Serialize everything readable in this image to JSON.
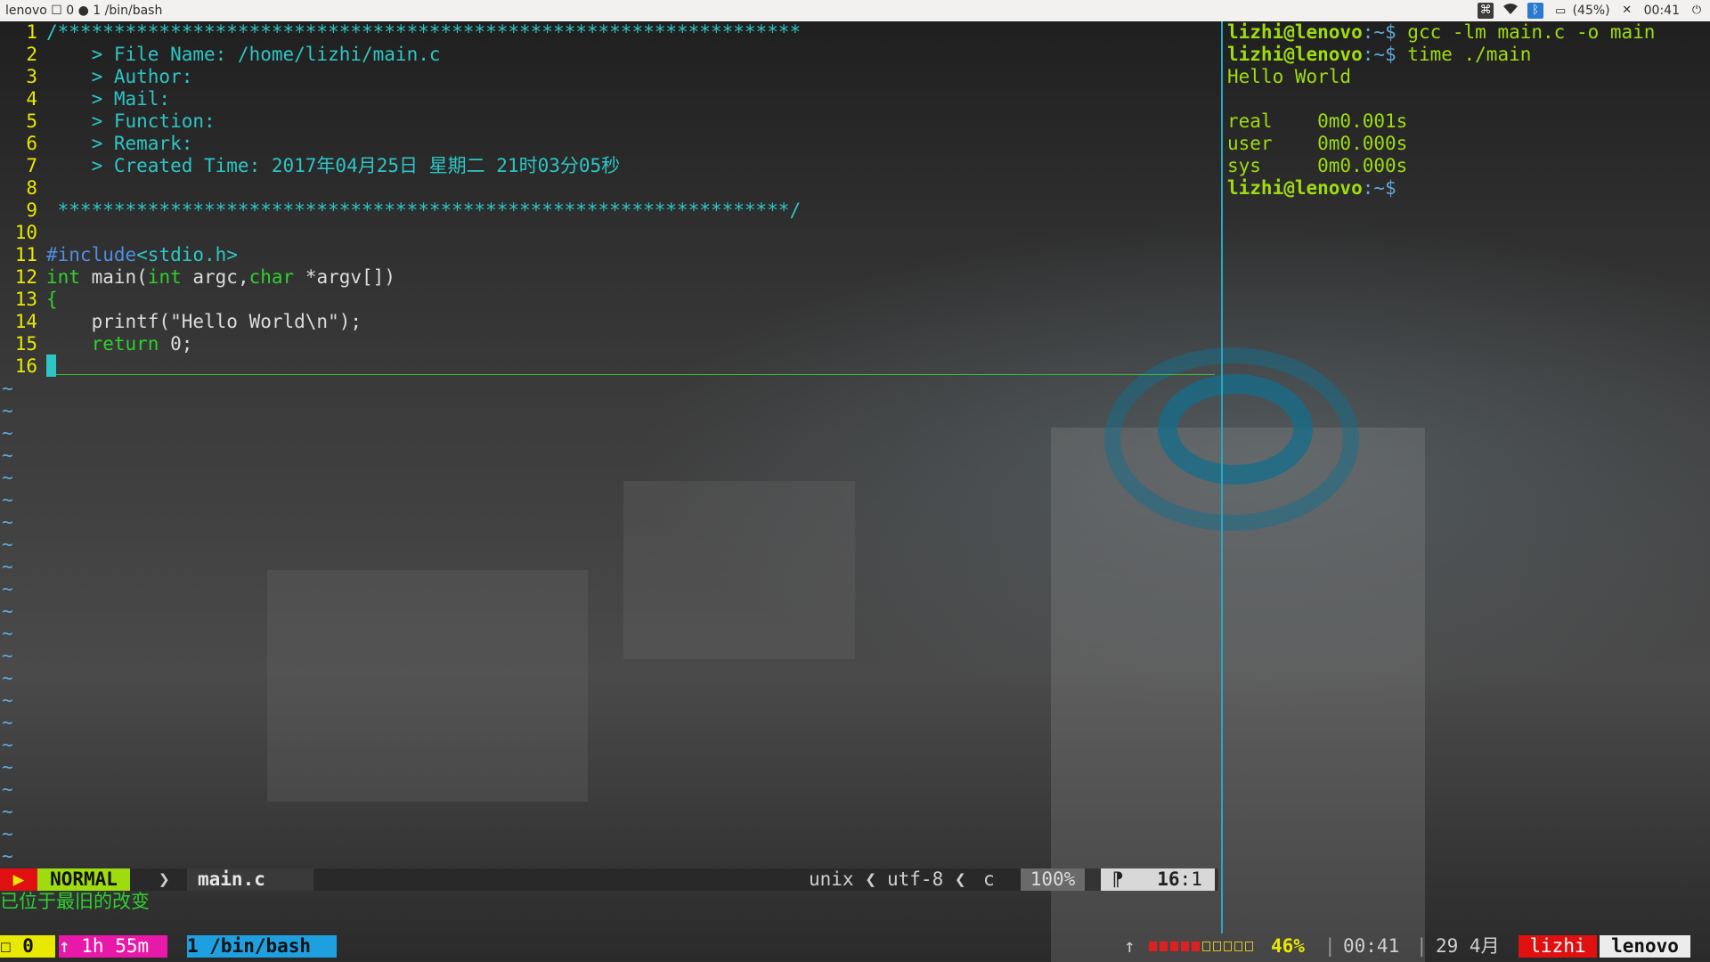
{
  "colors": {
    "accent": "#2ec5c5",
    "normal_mode": "#9edc10",
    "prompt": "#9edc10",
    "tmux_session": "#e8e800",
    "tmux_uptime": "#e818a8",
    "tmux_window": "#1ea0e0"
  },
  "topbar": {
    "title": "lenovo ☐ 0 ● 1 /bin/bash",
    "battery": "(45%)",
    "time": "00:41",
    "icons": [
      "keyboard-icon",
      "wifi-icon",
      "bluetooth-icon",
      "battery-icon",
      "mute-icon",
      "power-icon"
    ]
  },
  "vim": {
    "lines": [
      {
        "n": "1",
        "text": "/******************************************************************"
      },
      {
        "n": "2",
        "text": "    > File Name: /home/lizhi/main.c"
      },
      {
        "n": "3",
        "text": "    > Author:"
      },
      {
        "n": "4",
        "text": "    > Mail:"
      },
      {
        "n": "5",
        "text": "    > Function:"
      },
      {
        "n": "6",
        "text": "    > Remark:"
      },
      {
        "n": "7",
        "text": "    > Created Time: 2017年04月25日 星期二 21时03分05秒"
      },
      {
        "n": "8",
        "text": ""
      },
      {
        "n": "9",
        "text": " *****************************************************************/"
      },
      {
        "n": "10",
        "text": ""
      },
      {
        "n": "11",
        "include": "#include",
        "header": "<stdio.h>"
      },
      {
        "n": "12",
        "kw_int": "int",
        "fn": " main(",
        "kw_int2": "int",
        "args": " argc,",
        "kw_char": "char",
        "ptr": " *argv[])"
      },
      {
        "n": "13",
        "text": "{"
      },
      {
        "n": "14",
        "text": "    printf(\"Hello World\\n\");"
      },
      {
        "n": "15",
        "kw": "    return",
        "num": " 0;"
      },
      {
        "n": "16",
        "text": "}"
      }
    ],
    "tildes": [
      "~",
      "~",
      "~",
      "~",
      "~",
      "~",
      "~",
      "~",
      "~",
      "~",
      "~",
      "~",
      "~",
      "~",
      "~",
      "~",
      "~",
      "~",
      "~",
      "~",
      "~",
      "~"
    ],
    "status": {
      "mode_prefix": "▶",
      "mode": "NORMAL",
      "separator": "❯",
      "filename": "main.c",
      "fileformat": "unix ❮",
      "encoding": "utf-8 ❮",
      "filetype": "c",
      "percent": "100%",
      "position_icon": "⁋",
      "line": "16",
      "col": ":1"
    },
    "message": "已位于最旧的改变"
  },
  "shell": {
    "lines": [
      {
        "user": "lizhi@lenovo",
        "path": ":~$",
        "cmd": " gcc -lm main.c -o main"
      },
      {
        "user": "lizhi@lenovo",
        "path": ":~$",
        "cmd": " time ./main"
      },
      {
        "out": "Hello World"
      },
      {
        "out": ""
      },
      {
        "out": "real    0m0.001s"
      },
      {
        "out": "user    0m0.000s"
      },
      {
        "out": "sys     0m0.000s"
      },
      {
        "user": "lizhi@lenovo",
        "path": ":~$",
        "cmd": ""
      }
    ]
  },
  "tmux": {
    "session": "☐ 0",
    "uptime": "↑ 1h 55m",
    "window": "1 /bin/bash",
    "arrow": "↑",
    "battery_level": 0.46,
    "battery_cells": [
      1,
      1,
      1,
      1,
      1,
      0,
      0,
      0,
      0,
      0
    ],
    "battery_pct": "46%",
    "sep1": "|",
    "time": "00:41",
    "sep2": "|",
    "date": "29 4月",
    "user": "lizhi",
    "host": "lenovo"
  }
}
